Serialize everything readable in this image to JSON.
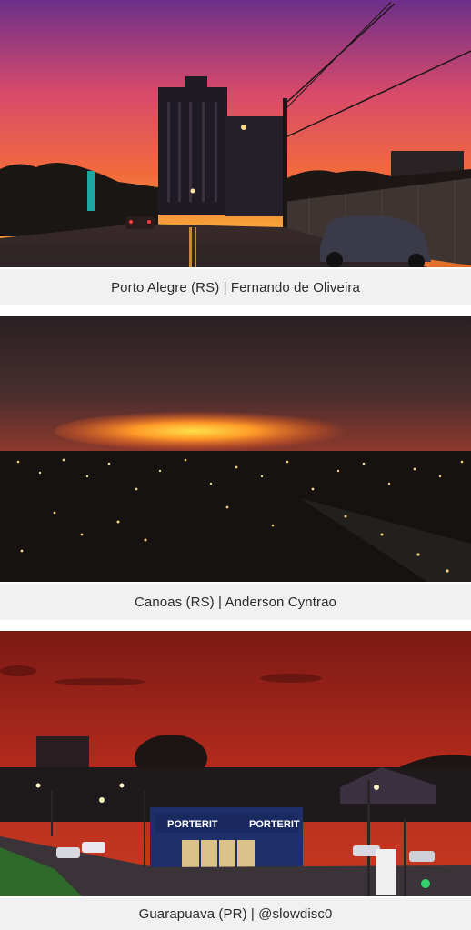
{
  "gallery": {
    "items": [
      {
        "caption": "Porto Alegre (RS) | Fernando de Oliveira",
        "photo": "sunset-street-photo"
      },
      {
        "caption": "Canoas (RS) | Anderson Cyntrao",
        "photo": "sunset-city-lights-photo"
      },
      {
        "caption": "Guarapuava (PR) | @slowdisc0",
        "photo": "red-sky-intersection-photo",
        "signs": [
          "PORTERIT",
          "PORTERIT"
        ]
      }
    ]
  }
}
